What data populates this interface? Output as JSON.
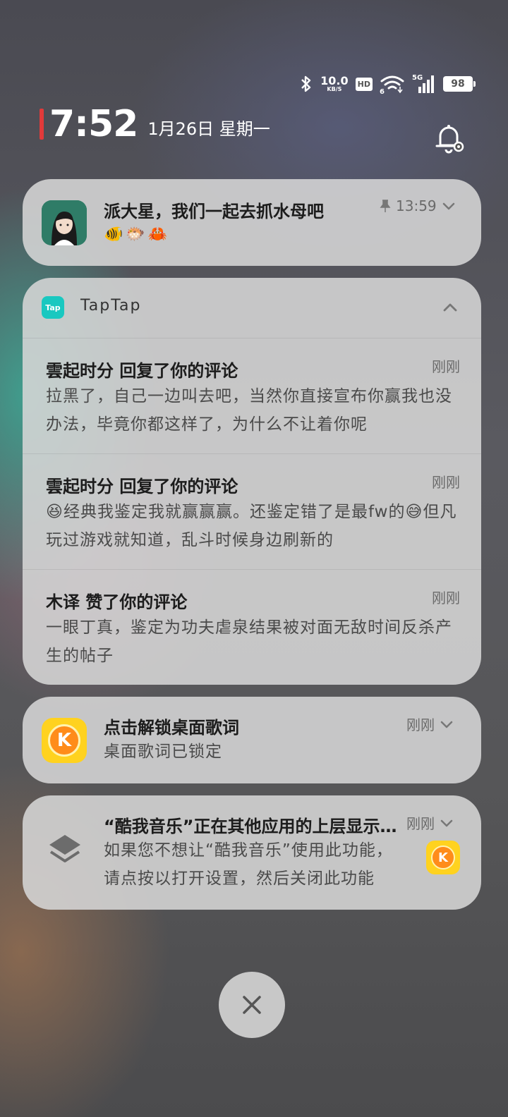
{
  "status_bar": {
    "speed_value": "10.0",
    "speed_unit": "KB/S",
    "hd": "HD",
    "wifi_badge": "6",
    "network": "5G",
    "battery": "98"
  },
  "clock": {
    "time": "7:52",
    "date": "1月26日 星期一"
  },
  "notifications": {
    "pinned": {
      "title": "派大星，我们一起去抓水母吧",
      "emojis": [
        "🐠",
        "🐡",
        "🦀"
      ],
      "time": "13:59"
    },
    "taptap": {
      "app_name": "TapTap",
      "logo_text": "Tap",
      "items": [
        {
          "title": "雲起时分 回复了你的评论",
          "time": "刚刚",
          "body": "拉黑了，自己一边叫去吧，当然你直接宣布你赢我也没办法，毕竟你都这样了，为什么不让着你呢"
        },
        {
          "title": "雲起时分 回复了你的评论",
          "time": "刚刚",
          "body": "😆经典我鉴定我就赢赢赢。还鉴定错了是最fw的😅但凡玩过游戏就知道，乱斗时候身边刷新的"
        },
        {
          "title": "木译 赞了你的评论",
          "time": "刚刚",
          "body": "一眼丁真，鉴定为功夫虐泉结果被对面无敌时间反杀产生的帖子"
        }
      ]
    },
    "lyrics": {
      "title": "点击解锁桌面歌词",
      "body": "桌面歌词已锁定",
      "time": "刚刚",
      "icon_letter": "K"
    },
    "overlay": {
      "title": "“酷我音乐”正在其他应用的上层显示内容",
      "body": "如果您不想让“酷我音乐”使用此功能，请点按以打开设置，然后关闭此功能",
      "time": "刚刚",
      "icon_letter": "K"
    }
  },
  "colors": {
    "accent_red": "#e23a3a",
    "taptap": "#19c8c0",
    "kuwo_yellow": "#ffd21f",
    "kuwo_orange": "#ff8c1a"
  }
}
